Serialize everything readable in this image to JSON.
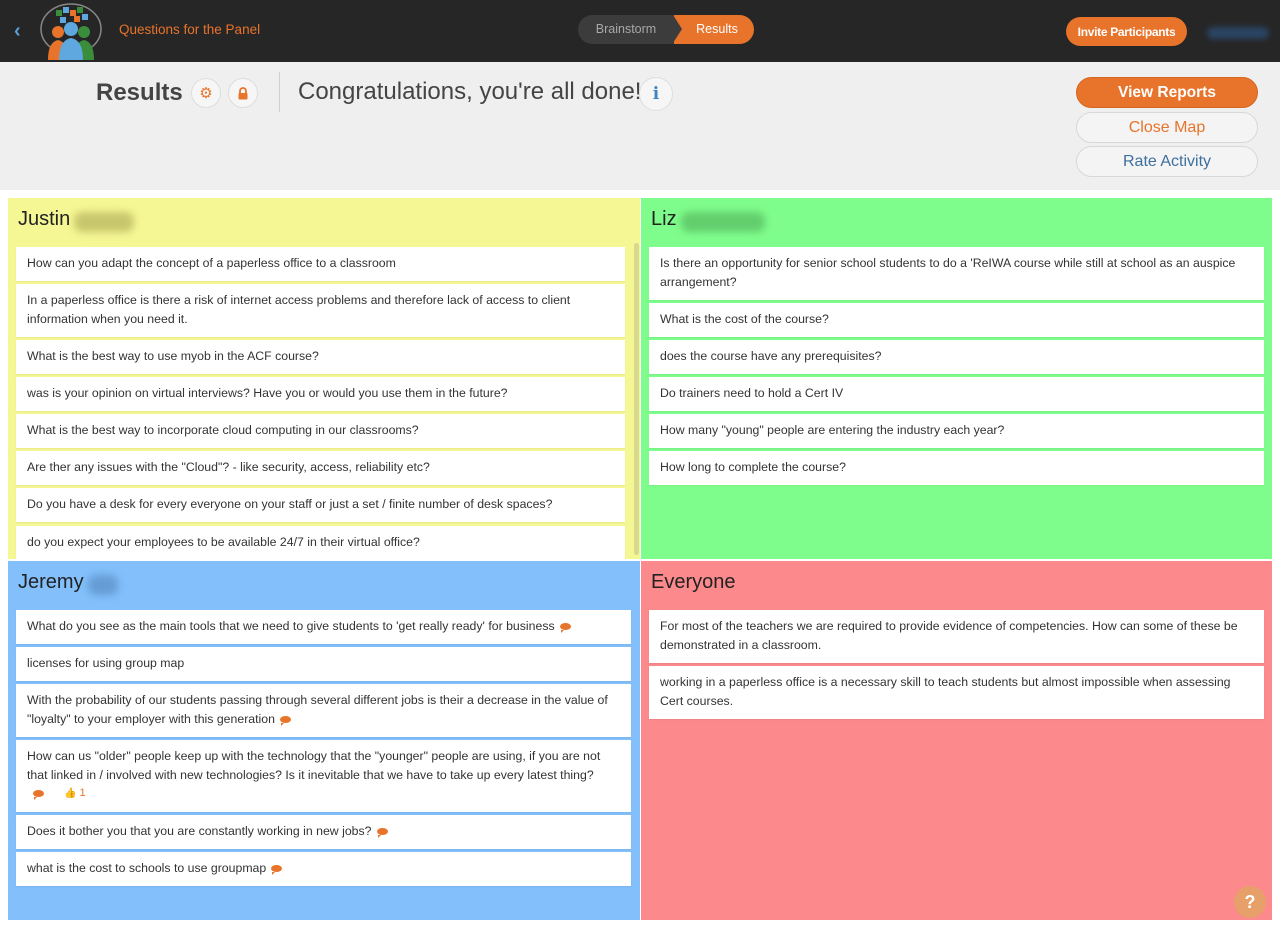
{
  "topbar": {
    "title": "Questions for the Panel",
    "steps": [
      {
        "label": "Brainstorm"
      },
      {
        "label": "Results"
      }
    ],
    "invite_label": "Invite Participants"
  },
  "header": {
    "title": "Results",
    "message": "Congratulations, you're all done!",
    "info_label": "i",
    "view_reports_label": "View Reports",
    "close_map_label": "Close Map",
    "rate_activity_label": "Rate Activity"
  },
  "panels": [
    {
      "name": "Justin",
      "color": "#f5f794",
      "items": [
        {
          "text": "How can you adapt the concept of a paperless office to a classroom"
        },
        {
          "text": "In a paperless office is there a risk of internet access problems and therefore lack of access to client information when you need it."
        },
        {
          "text": "What is the best way to use myob in the ACF course?"
        },
        {
          "text": "was is your opinion on virtual interviews? Have you or would you use them in the future?"
        },
        {
          "text": "What is the best way to incorporate cloud computing in our classrooms?"
        },
        {
          "text": "Are ther any issues with the \"Cloud\"? - like security, access, reliability etc?"
        },
        {
          "text": "Do you have a desk for every everyone on your staff or just a set / finite number of desk spaces?"
        },
        {
          "text": "do you expect your employees to be available 24/7 in their virtual office?"
        }
      ]
    },
    {
      "name": "Liz",
      "color": "#7ffd8c",
      "items": [
        {
          "text": "Is there an opportunity for senior school students to do a 'ReIWA course while still at school as an auspice arrangement?"
        },
        {
          "text": "What is the cost of the course?"
        },
        {
          "text": "does the course have any prerequisites?"
        },
        {
          "text": "Do trainers need to hold a Cert IV"
        },
        {
          "text": "How many \"young\" people are entering the industry each year?"
        },
        {
          "text": "How long to complete the course?"
        }
      ]
    },
    {
      "name": "Jeremy",
      "color": "#82bffb",
      "items": [
        {
          "text": "What do you see as the main tools that we need to give students to 'get really ready' for business"
        },
        {
          "text": "licenses for using group map"
        },
        {
          "text": "With the probability of our students passing through several different jobs is their a decrease in the value of \"loyalty\" to your employer with this generation"
        },
        {
          "text": "How can us \"older\" people keep up with the technology that the \"younger\" people are using, if you are not that linked in / involved with new technologies?  Is it inevitable that we have to take up every latest thing?",
          "likes": "1"
        },
        {
          "text": "Does it bother you that you are constantly working in new jobs?"
        },
        {
          "text": "what is the cost to schools to use groupmap"
        }
      ]
    },
    {
      "name": "Everyone",
      "color": "#fc8a8c",
      "items": [
        {
          "text": "For most of the teachers we are required to provide evidence of competencies. How can some of these be demonstrated in a classroom."
        },
        {
          "text": "working in a paperless office is a necessary skill to teach students but almost impossible when assessing Cert courses."
        }
      ]
    }
  ],
  "help_label": "?"
}
